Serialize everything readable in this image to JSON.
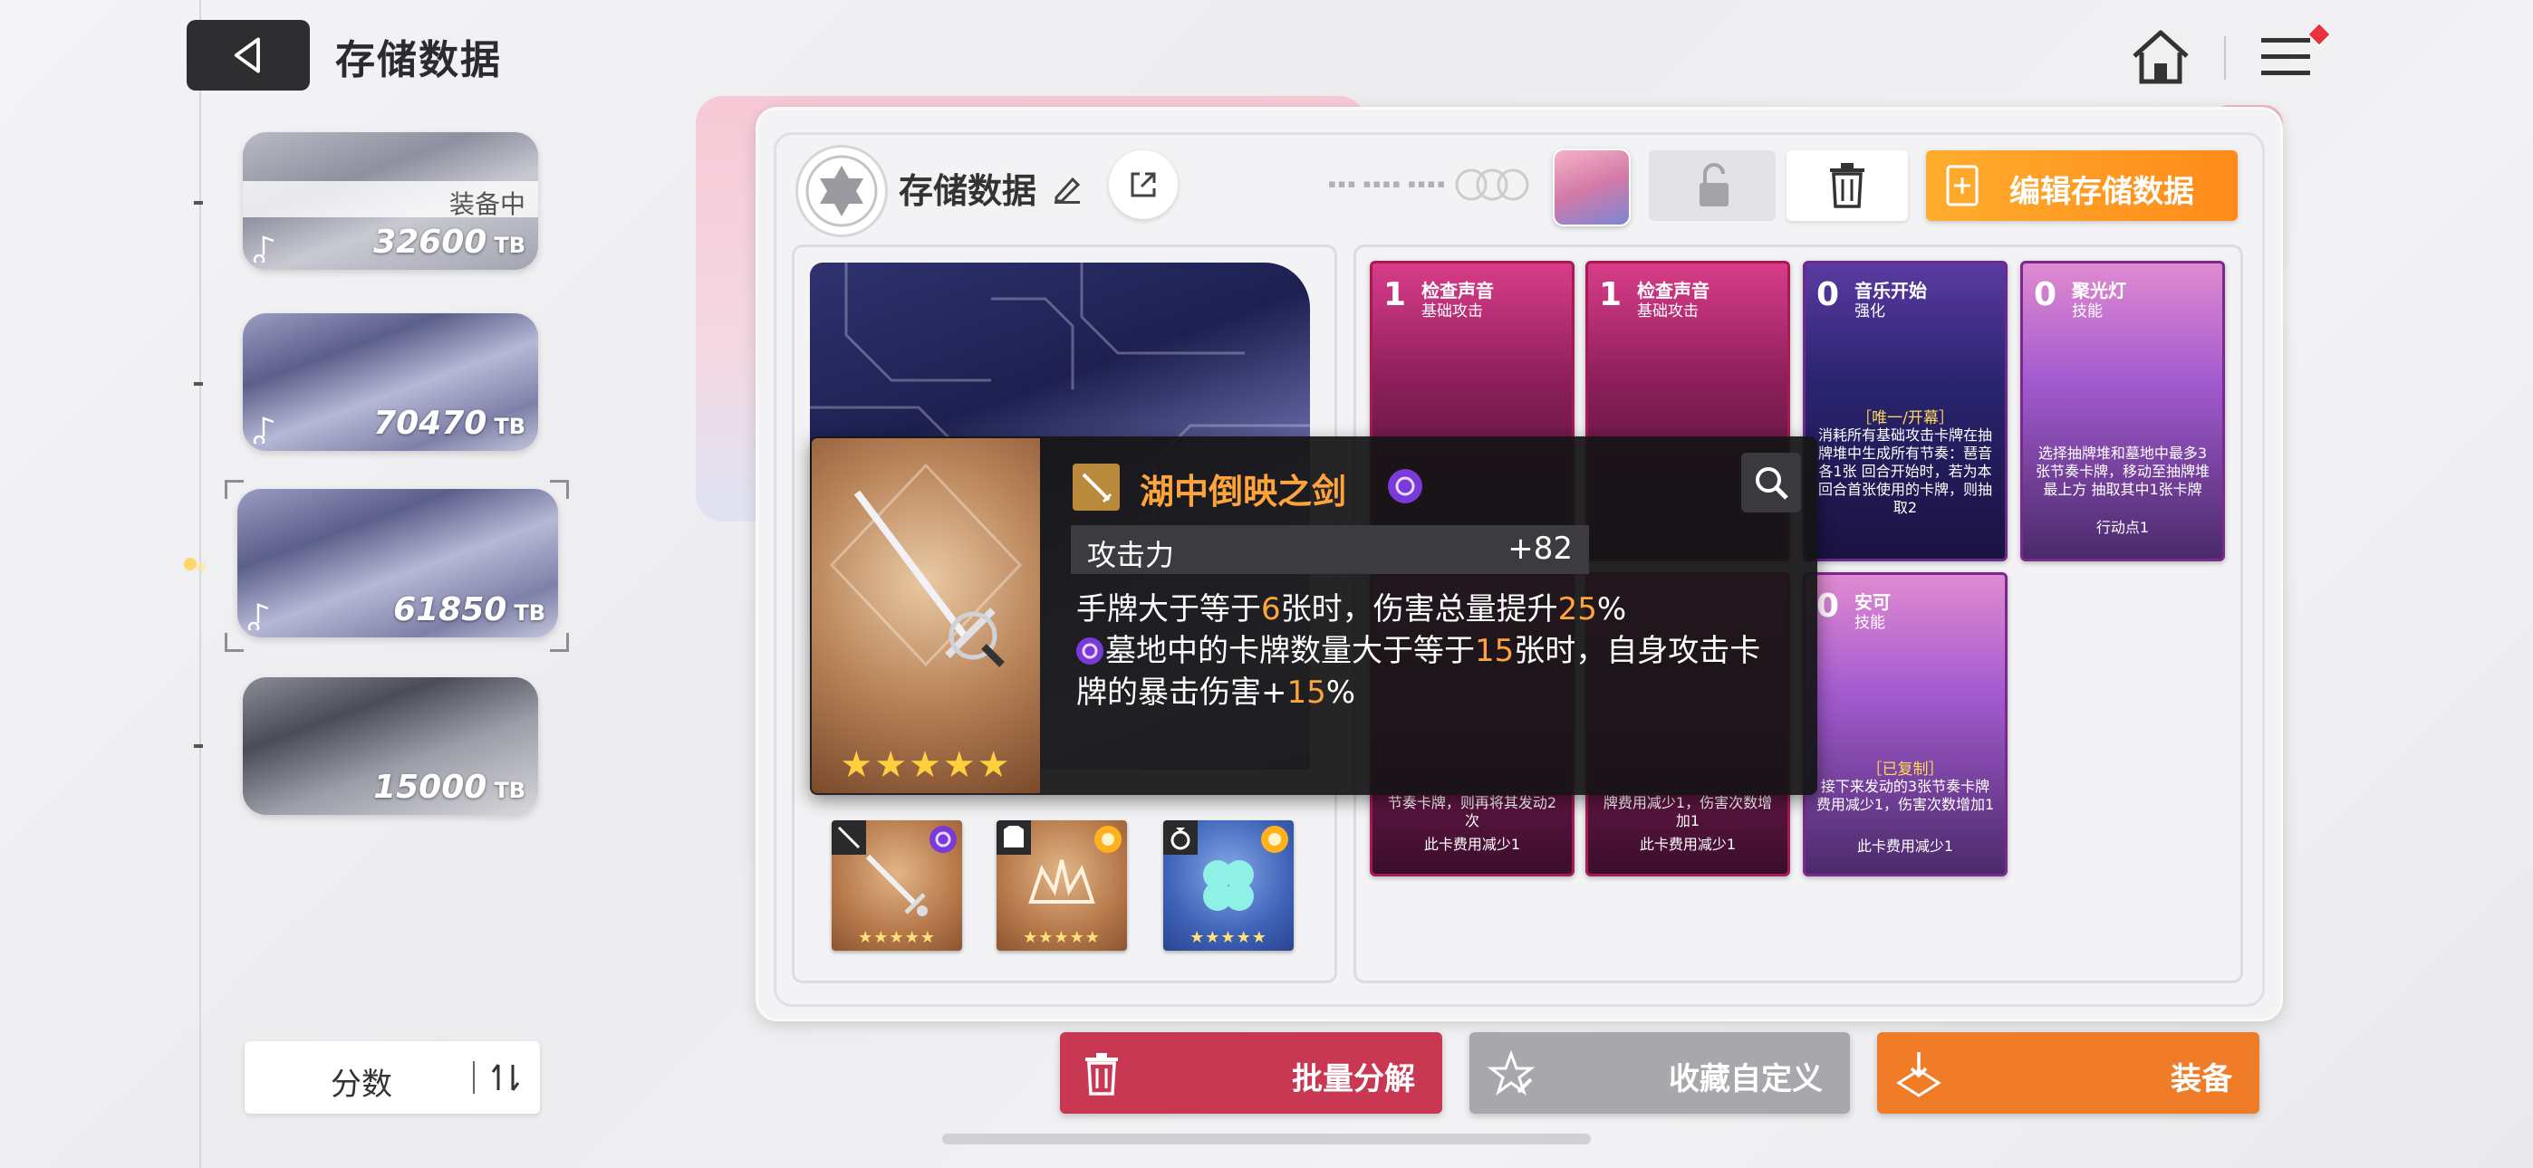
{
  "header": {
    "title": "存储数据"
  },
  "slots": [
    {
      "value": "32600",
      "unit": "TB",
      "status": "装备中"
    },
    {
      "value": "70470",
      "unit": "TB"
    },
    {
      "value": "61850",
      "unit": "TB"
    },
    {
      "value": "15000",
      "unit": "TB"
    }
  ],
  "sort": {
    "label": "分数"
  },
  "deck": {
    "name": "存储数据",
    "edit_label": "编辑存储数据"
  },
  "tooltip": {
    "name": "湖中倒映之剑",
    "stat_label": "攻击力",
    "stat_value": "+82",
    "line1": {
      "a": "手牌大于等于",
      "b": "6",
      "c": "张时，伤害总量提升",
      "d": "25",
      "e": "%"
    },
    "line2": {
      "a": "墓地中的卡牌数量大于等于",
      "b": "15",
      "c": "张时，自身攻击卡"
    },
    "line3": {
      "a": "牌的暴击伤害+",
      "b": "15",
      "c": "%"
    },
    "stars": "★★★★★"
  },
  "equipment": [
    {
      "type": "sword",
      "stars": "★★★★★",
      "frame": "bronze"
    },
    {
      "type": "armor",
      "stars": "★★★★★",
      "frame": "bronze"
    },
    {
      "type": "ring",
      "stars": "★★★★★",
      "frame": "blue"
    }
  ],
  "cards": [
    {
      "cost": "1",
      "name": "检查声音",
      "type": "基础攻击",
      "desc": "节奏卡牌，则再将其发动2次",
      "foot": "此卡费用减少1"
    },
    {
      "cost": "1",
      "name": "检查声音",
      "type": "基础攻击",
      "desc": "牌费用减少1，伤害次数增加1",
      "foot": "此卡费用减少1"
    },
    {
      "cost": "0",
      "name": "音乐开始",
      "type": "强化",
      "tag": "［唯一/开幕］",
      "desc": "消耗所有基础攻击卡牌在抽牌堆中生成所有节奏：琶音各1张 回合开始时，若为本回合首张使用的卡牌，则抽取2"
    },
    {
      "cost": "0",
      "name": "聚光灯",
      "type": "技能",
      "desc": "选择抽牌堆和墓地中最多3张节奏卡牌，移动至抽牌堆最上方 抽取其中1张卡牌",
      "foot": "行动点1"
    },
    {
      "cost": "0",
      "name": "安可",
      "type": "技能",
      "tag": "［已复制］",
      "desc": "接下来发动的3张节奏卡牌费用减少1，伤害次数增加1",
      "foot": "此卡费用减少1"
    }
  ],
  "bottom": {
    "bulk_label": "批量分解",
    "fav_label": "收藏自定义",
    "equip_label": "装备"
  },
  "colors": {
    "accent_orange": "#ff8a1a",
    "danger_red": "#c93852",
    "tooltip_highlight": "#ffa43a"
  }
}
